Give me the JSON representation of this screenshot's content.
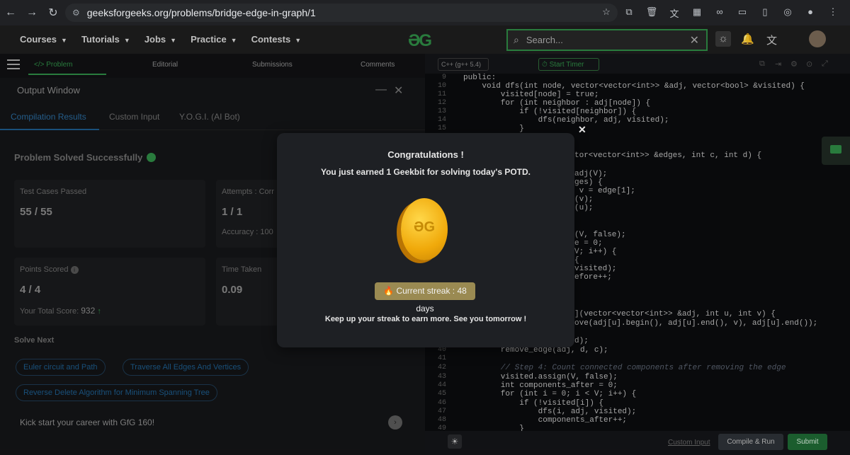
{
  "browser": {
    "url": "geeksforgeeks.org/problems/bridge-edge-in-graph/1"
  },
  "header": {
    "menu": [
      "Courses",
      "Tutorials",
      "Jobs",
      "Practice",
      "Contests"
    ],
    "logo": "ƏG",
    "search_placeholder": "Search..."
  },
  "problem_tabs": {
    "problem": "</> Problem",
    "editorial": "Editorial",
    "submissions": "Submissions",
    "comments": "Comments"
  },
  "output_window": {
    "title": "Output Window",
    "tabs": [
      "Compilation Results",
      "Custom Input",
      "Y.O.G.I. (AI Bot)"
    ],
    "status": "Problem Solved Successfully",
    "test_cases_label": "Test Cases Passed",
    "test_cases_value": "55 / 55",
    "attempts_label": "Attempts : Corr",
    "attempts_value": "1 / 1",
    "accuracy": "Accuracy : 100",
    "points_label": "Points Scored",
    "points_value": "4 / 4",
    "total_score_label": "Your Total Score:",
    "total_score_value": "932",
    "time_label": "Time Taken",
    "time_value": "0.09",
    "solve_next": "Solve Next",
    "chips": [
      "Euler circuit and Path",
      "Traverse All Edges And Vertices",
      "Reverse Delete Algorithm for Minimum Spanning Tree"
    ],
    "gfg160": "Kick start your career with GfG 160!"
  },
  "editor": {
    "language": "C++ (g++ 5.4)",
    "timer": "Start Timer",
    "line_numbers": [
      "9",
      "10",
      "11",
      "12",
      "13",
      "14",
      "15",
      "",
      "",
      "",
      "",
      "",
      "",
      "",
      "",
      "",
      "",
      "",
      "",
      "",
      "",
      "",
      "",
      "",
      "",
      "",
      "",
      "",
      "",
      "",
      "",
      "",
      "",
      "",
      "",
      "",
      "",
      "40",
      "41",
      "42",
      "43",
      "44",
      "45",
      "46",
      "47",
      "48",
      "49"
    ],
    "lines": [
      "public:",
      "    void dfs(int node, vector<vector<int>> &adj, vector<bool> &visited) {",
      "        visited[node] = true;",
      "        for (int neighbor : adj[node]) {",
      "            if (!visited[neighbor]) {",
      "                dfs(neighbor, adj, visited);",
      "            }",
      "tor<vector<int>> &edges, int c, int d) {",
      "adj(V);",
      "ges) {",
      " v = edge[1];",
      "(v);",
      "(u);",
      "(V, false);",
      "e = 0;",
      "V; i++) {",
      "{",
      "visited);",
      "efore++;",
      "](vector<vector<int>> &adj, int u, int v) {",
      "ove(adj[u].begin(), adj[u].end(), v), adj[u].end());",
      "d);",
      "        remove_edge(adj, d, c);",
      "        // Step 4: Count connected components after removing the edge",
      "        visited.assign(V, false);",
      "        int components_after = 0;",
      "        for (int i = 0; i < V; i++) {",
      "            if (!visited[i]) {",
      "                dfs(i, adj, visited);",
      "                components_after++;",
      "            }"
    ],
    "custom_input": "Custom Input",
    "compile_run": "Compile & Run",
    "submit": "Submit"
  },
  "modal": {
    "title": "Congratulations !",
    "message": "You just earned 1 Geekbit for solving today's POTD.",
    "coin_logo": "ƏG",
    "streak": "🔥 Current streak : 48 days",
    "footer": "Keep up your streak to earn more. See you tomorrow !"
  }
}
